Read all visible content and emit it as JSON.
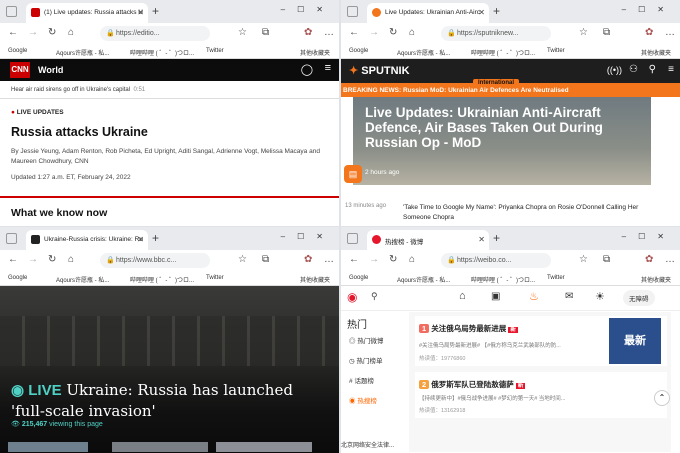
{
  "common": {
    "new_tab": "+",
    "bookmarks": [
      "Google",
      "Aqours许愿瓶 - 私...",
      "哔哩哔哩 ( ゜- ゜)つロ...",
      "Twitter",
      "其他收藏夹"
    ]
  },
  "cnn": {
    "tab_title": "(1) Live updates: Russia attacks U",
    "url": "https://editio...",
    "section": "World",
    "ticker": "Hear air raid sirens go off in Ukraine's capital",
    "ticker_time": "0:51",
    "label": "LIVE UPDATES",
    "headline": "Russia attacks Ukraine",
    "byline": "By Jessie Yeung, Adam Renton, Rob Picheta, Ed Upright, Aditi Sangal, Adrienne Vogt, Melissa Macaya and Maureen Chowdhury, CNN",
    "updated": "Updated 1:27 a.m. ET, February 24, 2022",
    "subhead": "What we know now"
  },
  "sputnik": {
    "tab_title": "Live Updates: Ukrainian Anti-Airc",
    "url": "https://sputniknew...",
    "logo": "SPUTNIK",
    "badge": "International",
    "breaking": "BREAKING NEWS: Russian MoD: Ukrainian Air Defences Are Neutralised",
    "headline": "Live Updates: Ukrainian Anti-Aircraft Defence, Air Bases Taken Out During Russian Op - MoD",
    "ago": "2 hours ago",
    "item_time": "13 minutes ago",
    "item_text": "'Take Time to Google My Name': Priyanka Chopra on Rosie O'Donnell Calling Her Someone Chopra"
  },
  "bbc": {
    "tab_title": "Ukraine-Russia crisis: Ukraine: Ru",
    "url": "https://www.bbc.c...",
    "live": "LIVE",
    "headline": "Ukraine: Russia has launched 'full-scale invasion'",
    "viewers": "215,467",
    "viewers_label": "viewing this page"
  },
  "weibo": {
    "tab_title": "热搜榜 - 微博",
    "url": "https://weibo.co...",
    "login": "无障碍",
    "side_title": "热门",
    "side_items": [
      "热门微博",
      "热门榜单",
      "话题榜",
      "热搜榜"
    ],
    "items": [
      {
        "rank": "1",
        "title": "关注俄乌局势最新进展",
        "tag": "新",
        "desc": "#关注俄乌局势最新进展# 【#俄方称乌克兰武装部队的防...",
        "heat": "热读值：19776860"
      },
      {
        "rank": "2",
        "title": "俄罗斯军队已登陆敖德萨",
        "tag": "新",
        "desc": "【持续更新中】#俄乌战争进展# #梦幻的第一天# 当地时间...",
        "heat": "热读值：13162918"
      }
    ],
    "thumb_text": "最新",
    "footer": "北京网络安全法律..."
  }
}
